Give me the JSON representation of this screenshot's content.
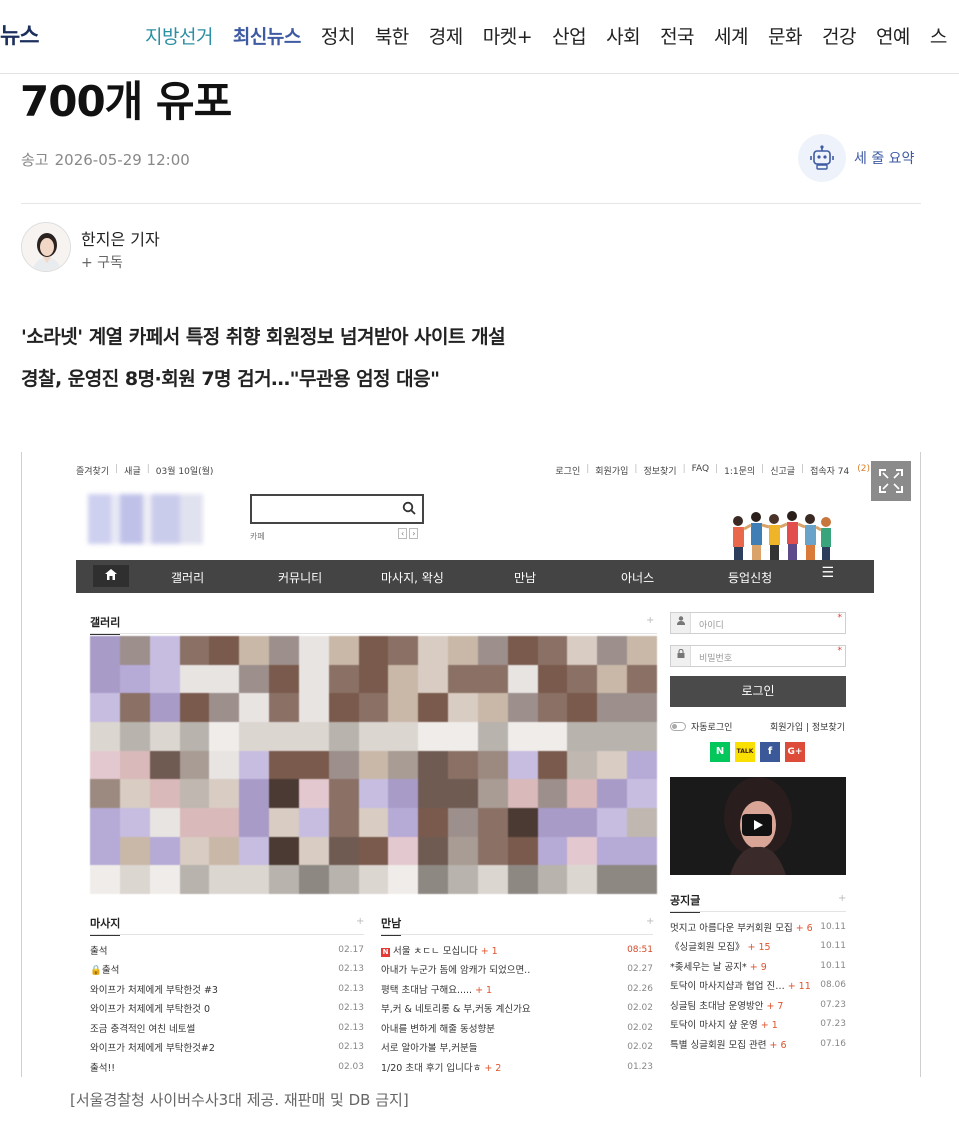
{
  "nav": {
    "logo_fragment": "뉴스",
    "items": [
      "지방선거",
      "최신뉴스",
      "정치",
      "북한",
      "경제",
      "마켓+",
      "산업",
      "사회",
      "전국",
      "세계",
      "문화",
      "건강",
      "연예",
      "스"
    ]
  },
  "article": {
    "headline": "700개 유포",
    "sent_label": "송고",
    "sent_datetime": "2026-05-29 12:00",
    "summary_label": "세 줄 요약",
    "reporter": "한지은 기자",
    "subscribe": "+ 구독",
    "subheads": [
      "'소라넷' 계열 카페서 특정 취향 회원정보 넘겨받아 사이트 개설",
      "경찰, 운영진 8명·회원 7명 검거…\"무관용 엄정 대응\""
    ],
    "caption": "[서울경찰청 사이버수사3대 제공. 재판매 및 DB 금지]"
  },
  "site": {
    "util_left": [
      "즐겨찾기",
      "새글",
      "03월 10일(월)"
    ],
    "util_right": [
      "로그인",
      "회원가입",
      "정보찾기",
      "FAQ",
      "1:1문의",
      "신고글",
      "접속자 74"
    ],
    "online_count": "(2)",
    "cafe_label": "카페",
    "menu": [
      "갤러리",
      "커뮤니티",
      "마사지, 왁싱",
      "만남",
      "아너스",
      "등업신청"
    ],
    "gallery_title": "갤러리",
    "massage": {
      "title": "마사지",
      "rows": [
        {
          "t": "출석",
          "d": "02.17"
        },
        {
          "t": "🔒출석",
          "d": "02.13"
        },
        {
          "t": "와이프가 처제에게 부탁한것 #3",
          "d": "02.13"
        },
        {
          "t": "와이프가 처제에게 부탁한것 0",
          "d": "02.13"
        },
        {
          "t": "조금 충격적인 여친 네토썰",
          "d": "02.13"
        },
        {
          "t": "와이프가 처제에게 부탁한것#2",
          "d": "02.13"
        },
        {
          "t": "출석!!",
          "d": "02.03"
        }
      ]
    },
    "meet": {
      "title": "만남",
      "rows": [
        {
          "n": "N",
          "t": "서울 ㅊㄷㄴ 모십니다",
          "c": "+ 1",
          "d": "08:51"
        },
        {
          "t": "아내가 누군가 돔에 암캐가 되었으면..",
          "d": "02.27"
        },
        {
          "t": "평택 초대남 구해요.....",
          "c": "+ 1",
          "d": "02.26"
        },
        {
          "t": "부,커 & 네토리롱 & 부,커동 계신가요",
          "d": "02.02"
        },
        {
          "t": "아내를 변하게 해줄 동성향분",
          "d": "02.02"
        },
        {
          "t": "서로 알아가볼 부,커분들",
          "d": "02.02"
        },
        {
          "t": "1/20 초대 후기 입니다ㅎ",
          "c": "+ 2",
          "d": "01.23"
        }
      ]
    },
    "login": {
      "id_placeholder": "아이디",
      "pw_placeholder": "비밀번호",
      "button": "로그인",
      "auto_login": "자동로그인",
      "join_links": "회원가입 | 정보찾기",
      "social": [
        "N",
        "TALK",
        "f",
        "G+"
      ]
    },
    "notice": {
      "title": "공지글",
      "rows": [
        {
          "t": "멋지고 아름다운 부커회원 모집",
          "c": "+ 6",
          "d": "10.11"
        },
        {
          "t": "《싱글회원 모집》",
          "c": "+ 15",
          "d": "10.11"
        },
        {
          "t": "*좆세우는 날 공지*",
          "c": "+ 9",
          "d": "10.11"
        },
        {
          "t": "토닥이 마사지샵과 협업 진…",
          "c": "+ 11",
          "d": "08.06"
        },
        {
          "t": "싱글팀 초대남 운영방안",
          "c": "+ 7",
          "d": "07.23"
        },
        {
          "t": "토닥이 마사지 샾 운영",
          "c": "+ 1",
          "d": "07.23"
        },
        {
          "t": "특별 싱글회원 모집 관련",
          "c": "+ 6",
          "d": "07.16"
        }
      ]
    }
  },
  "colors": {
    "nav_accent": "#2c8fa4",
    "nav_active": "#3d5aa3",
    "site_menu_bg": "#444444",
    "comment_count": "#e0532d"
  }
}
